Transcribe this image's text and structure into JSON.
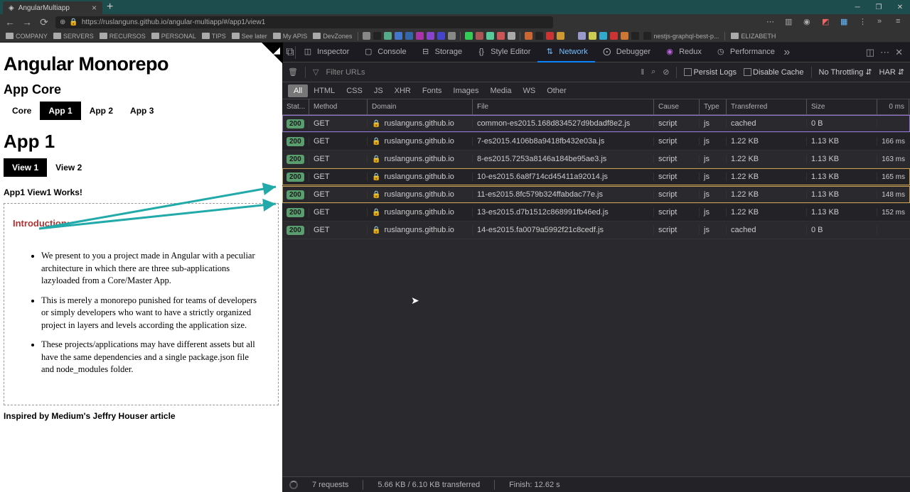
{
  "browser": {
    "tab_title": "AngularMultiapp",
    "url": "https://ruslanguns.github.io/angular-multiapp/#/app1/view1",
    "bookmarks_folders": [
      "COMPANY",
      "SERVERS",
      "RECURSOS",
      "PERSONAL",
      "TIPS",
      "See later",
      "My APIS",
      "DevZones"
    ],
    "bookmark_link": "nestjs-graphql-best-p...",
    "bookmark_link2": "ELIZABETH"
  },
  "page": {
    "title": "Angular Monorepo",
    "subtitle": "App Core",
    "nav": [
      "Core",
      "App 1",
      "App 2",
      "App 3"
    ],
    "nav_active": 1,
    "h3": "App 1",
    "views": [
      "View 1",
      "View 2"
    ],
    "view_active": 0,
    "works": "App1 View1 Works!",
    "intro_title": "Introduction:",
    "bullets": [
      "We present to you a project made in Angular with a peculiar architecture in which there are three sub-applications lazyloaded from a Core/Master App.",
      "This is merely a monorepo punished for teams of developers or simply developers who want to have a strictly organized project in layers and levels according the application size.",
      "These projects/applications may have different assets but all have the same dependencies and a single package.json file and node_modules folder."
    ],
    "inspired": "Inspired by Medium's Jeffry Houser article"
  },
  "devtools": {
    "tabs": [
      "Inspector",
      "Console",
      "Storage",
      "Style Editor",
      "Network",
      "Debugger",
      "Redux",
      "Performance"
    ],
    "tabs_active": 4,
    "filter_placeholder": "Filter URLs",
    "persist_logs": "Persist Logs",
    "disable_cache": "Disable Cache",
    "throttling": "No Throttling",
    "har": "HAR",
    "filter_tabs": [
      "All",
      "HTML",
      "CSS",
      "JS",
      "XHR",
      "Fonts",
      "Images",
      "Media",
      "WS",
      "Other"
    ],
    "filter_active": 0,
    "headers": {
      "status": "Stat...",
      "method": "Method",
      "domain": "Domain",
      "file": "File",
      "cause": "Cause",
      "type": "Type",
      "transferred": "Transferred",
      "size": "Size",
      "time": "0 ms"
    },
    "requests": [
      {
        "status": "200",
        "method": "GET",
        "domain": "ruslanguns.github.io",
        "file": "common-es2015.168d834527d9bdadf8e2.js",
        "cause": "script",
        "type": "js",
        "transferred": "cached",
        "size": "0 B",
        "time": "",
        "hl": "purple"
      },
      {
        "status": "200",
        "method": "GET",
        "domain": "ruslanguns.github.io",
        "file": "7-es2015.4106b8a9418fb432e03a.js",
        "cause": "script",
        "type": "js",
        "transferred": "1.22 KB",
        "size": "1.13 KB",
        "time": "166 ms",
        "hl": ""
      },
      {
        "status": "200",
        "method": "GET",
        "domain": "ruslanguns.github.io",
        "file": "8-es2015.7253a8146a184be95ae3.js",
        "cause": "script",
        "type": "js",
        "transferred": "1.22 KB",
        "size": "1.13 KB",
        "time": "163 ms",
        "hl": ""
      },
      {
        "status": "200",
        "method": "GET",
        "domain": "ruslanguns.github.io",
        "file": "10-es2015.6a8f714cd45411a92014.js",
        "cause": "script",
        "type": "js",
        "transferred": "1.22 KB",
        "size": "1.13 KB",
        "time": "165 ms",
        "hl": "yellow"
      },
      {
        "status": "200",
        "method": "GET",
        "domain": "ruslanguns.github.io",
        "file": "11-es2015.8fc579b324ffabdac77e.js",
        "cause": "script",
        "type": "js",
        "transferred": "1.22 KB",
        "size": "1.13 KB",
        "time": "148 ms",
        "hl": "yellow"
      },
      {
        "status": "200",
        "method": "GET",
        "domain": "ruslanguns.github.io",
        "file": "13-es2015.d7b1512c868991fb46ed.js",
        "cause": "script",
        "type": "js",
        "transferred": "1.22 KB",
        "size": "1.13 KB",
        "time": "152 ms",
        "hl": ""
      },
      {
        "status": "200",
        "method": "GET",
        "domain": "ruslanguns.github.io",
        "file": "14-es2015.fa0079a5992f21c8cedf.js",
        "cause": "script",
        "type": "js",
        "transferred": "cached",
        "size": "0 B",
        "time": "",
        "hl": ""
      }
    ],
    "footer": {
      "requests": "7 requests",
      "transferred": "5.66 KB / 6.10 KB transferred",
      "finish": "Finish: 12.62 s"
    }
  }
}
